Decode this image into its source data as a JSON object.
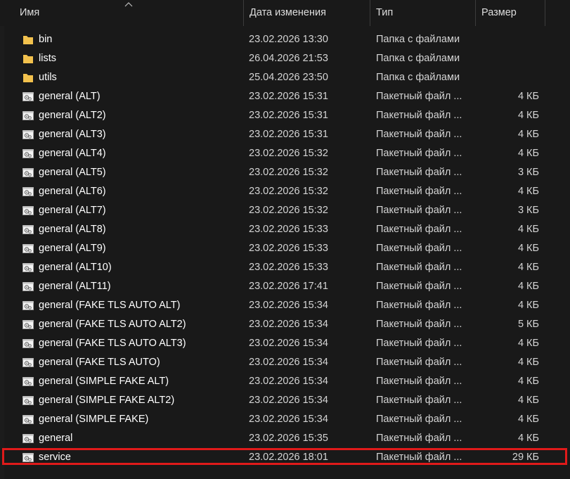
{
  "columns": {
    "name": "Имя",
    "date": "Дата изменения",
    "type": "Тип",
    "size": "Размер"
  },
  "colors": {
    "background": "#191919",
    "folder": "#f2c14e",
    "highlight_border": "#e01a1a"
  },
  "files": [
    {
      "name": "bin",
      "date": "23.02.2026 13:30",
      "type": "Папка с файлами",
      "size": "",
      "icon": "folder-icon"
    },
    {
      "name": "lists",
      "date": "26.04.2026 21:53",
      "type": "Папка с файлами",
      "size": "",
      "icon": "folder-icon"
    },
    {
      "name": "utils",
      "date": "25.04.2026 23:50",
      "type": "Папка с файлами",
      "size": "",
      "icon": "folder-icon"
    },
    {
      "name": "general (ALT)",
      "date": "23.02.2026 15:31",
      "type": "Пакетный файл ...",
      "size": "4 КБ",
      "icon": "batch-file-icon"
    },
    {
      "name": "general (ALT2)",
      "date": "23.02.2026 15:31",
      "type": "Пакетный файл ...",
      "size": "4 КБ",
      "icon": "batch-file-icon"
    },
    {
      "name": "general (ALT3)",
      "date": "23.02.2026 15:31",
      "type": "Пакетный файл ...",
      "size": "4 КБ",
      "icon": "batch-file-icon"
    },
    {
      "name": "general (ALT4)",
      "date": "23.02.2026 15:32",
      "type": "Пакетный файл ...",
      "size": "4 КБ",
      "icon": "batch-file-icon"
    },
    {
      "name": "general (ALT5)",
      "date": "23.02.2026 15:32",
      "type": "Пакетный файл ...",
      "size": "3 КБ",
      "icon": "batch-file-icon"
    },
    {
      "name": "general (ALT6)",
      "date": "23.02.2026 15:32",
      "type": "Пакетный файл ...",
      "size": "4 КБ",
      "icon": "batch-file-icon"
    },
    {
      "name": "general (ALT7)",
      "date": "23.02.2026 15:32",
      "type": "Пакетный файл ...",
      "size": "3 КБ",
      "icon": "batch-file-icon"
    },
    {
      "name": "general (ALT8)",
      "date": "23.02.2026 15:33",
      "type": "Пакетный файл ...",
      "size": "4 КБ",
      "icon": "batch-file-icon"
    },
    {
      "name": "general (ALT9)",
      "date": "23.02.2026 15:33",
      "type": "Пакетный файл ...",
      "size": "4 КБ",
      "icon": "batch-file-icon"
    },
    {
      "name": "general (ALT10)",
      "date": "23.02.2026 15:33",
      "type": "Пакетный файл ...",
      "size": "4 КБ",
      "icon": "batch-file-icon"
    },
    {
      "name": "general (ALT11)",
      "date": "23.02.2026 17:41",
      "type": "Пакетный файл ...",
      "size": "4 КБ",
      "icon": "batch-file-icon"
    },
    {
      "name": "general (FAKE TLS AUTO ALT)",
      "date": "23.02.2026 15:34",
      "type": "Пакетный файл ...",
      "size": "4 КБ",
      "icon": "batch-file-icon"
    },
    {
      "name": "general (FAKE TLS AUTO ALT2)",
      "date": "23.02.2026 15:34",
      "type": "Пакетный файл ...",
      "size": "5 КБ",
      "icon": "batch-file-icon"
    },
    {
      "name": "general (FAKE TLS AUTO ALT3)",
      "date": "23.02.2026 15:34",
      "type": "Пакетный файл ...",
      "size": "4 КБ",
      "icon": "batch-file-icon"
    },
    {
      "name": "general (FAKE TLS AUTO)",
      "date": "23.02.2026 15:34",
      "type": "Пакетный файл ...",
      "size": "4 КБ",
      "icon": "batch-file-icon"
    },
    {
      "name": "general (SIMPLE FAKE ALT)",
      "date": "23.02.2026 15:34",
      "type": "Пакетный файл ...",
      "size": "4 КБ",
      "icon": "batch-file-icon"
    },
    {
      "name": "general (SIMPLE FAKE ALT2)",
      "date": "23.02.2026 15:34",
      "type": "Пакетный файл ...",
      "size": "4 КБ",
      "icon": "batch-file-icon"
    },
    {
      "name": "general (SIMPLE FAKE)",
      "date": "23.02.2026 15:34",
      "type": "Пакетный файл ...",
      "size": "4 КБ",
      "icon": "batch-file-icon"
    },
    {
      "name": "general",
      "date": "23.02.2026 15:35",
      "type": "Пакетный файл ...",
      "size": "4 КБ",
      "icon": "batch-file-icon"
    },
    {
      "name": "service",
      "date": "23.02.2026 18:01",
      "type": "Пакетный файл ...",
      "size": "29 КБ",
      "icon": "batch-file-icon",
      "highlighted": true
    }
  ]
}
